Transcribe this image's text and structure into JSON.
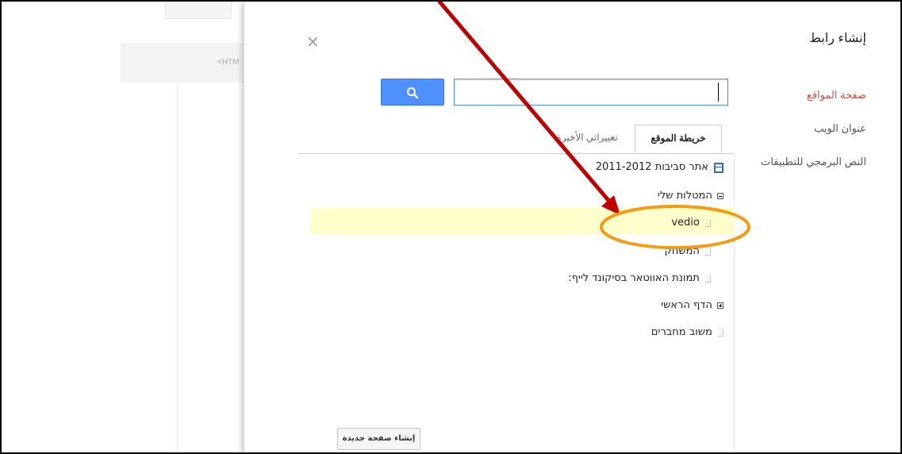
{
  "background_editor": {
    "html_label": "<HTM"
  },
  "dialog": {
    "title": "إنشاء رابط",
    "close_glyph": "×",
    "side_nav": [
      {
        "label": "صفحة المواقع",
        "active": true
      },
      {
        "label": "عنوان الويب",
        "active": false
      },
      {
        "label": "النص البرمجي للتطبيقات",
        "active": false
      }
    ],
    "search": {
      "value": "",
      "placeholder": ""
    },
    "tabs": [
      {
        "label": "خريطة الموقع",
        "active": true
      },
      {
        "label": "تغييراتي الأخيرة",
        "active": false
      }
    ],
    "tree": {
      "root": "אתר סביבות 2011-2012",
      "group1": "המטלות שלי",
      "item_vedio": "vedio",
      "item_hamesha": "המשחק",
      "item_avatar": "תמונת האווטאר בסיקונד לייף:",
      "group2": "הדף הראשי",
      "item_feedback": "משוב מחברים"
    },
    "new_page_button": "إنشاء صفحة جديدة"
  },
  "colors": {
    "search_button": "#4d90fe",
    "active_nav": "#dd4b39",
    "highlight_row": "#ffffcc",
    "annotation_arrow": "#c00000",
    "annotation_ellipse": "#f39c12"
  }
}
